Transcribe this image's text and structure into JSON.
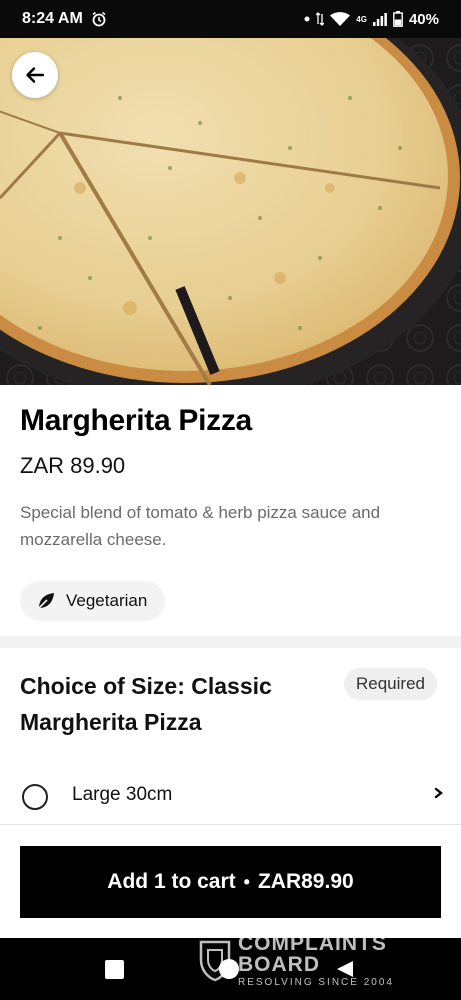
{
  "status_bar": {
    "time": "8:24",
    "time_suffix": "AM",
    "network": "4G",
    "battery": "40%"
  },
  "item": {
    "title": "Margherita Pizza",
    "price": "ZAR 89.90",
    "description": "Special blend of tomato & herb pizza sauce and mozzarella cheese.",
    "tag_label": "Vegetarian",
    "tag_icon": "leaf-icon"
  },
  "size_section": {
    "title": "Choice of Size: Classic Margherita Pizza",
    "badge": "Required",
    "options": [
      {
        "label": "Large 30cm",
        "selected": false
      }
    ]
  },
  "cart_button": {
    "label": "Add 1 to cart",
    "separator": "•",
    "price": "ZAR89.90"
  },
  "watermark": {
    "main_line_1": "COMPLAINTS",
    "main_line_2": "BOARD",
    "sub_line": "RESOLVING SINCE 2004"
  },
  "colors": {
    "accent": "#000000",
    "pill_bg": "#f3f3f3",
    "muted_text": "#6b6b6b"
  }
}
